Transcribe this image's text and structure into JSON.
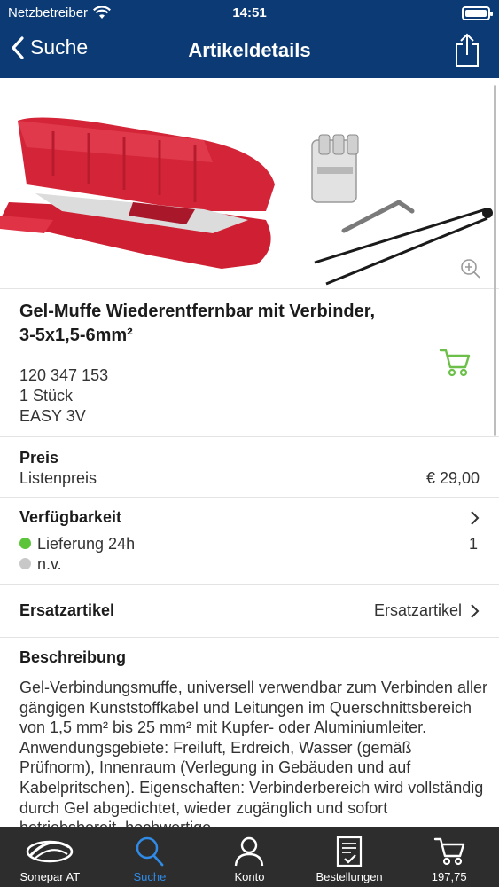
{
  "status": {
    "carrier": "Netzbetreiber",
    "time": "14:51"
  },
  "nav": {
    "back_label": "Suche",
    "title": "Artikeldetails"
  },
  "product": {
    "title": "Gel-Muffe Wiederentfernbar mit Verbinder, 3-5x1,5-6mm²",
    "article_number": "120 347 153",
    "unit": "1 Stück",
    "model": "EASY 3V"
  },
  "price": {
    "section": "Preis",
    "label": "Listenpreis",
    "value": "€ 29,00"
  },
  "availability": {
    "section": "Verfügbarkeit",
    "rows": [
      {
        "label": "Lieferung 24h",
        "value": "1",
        "color": "#5cc43a"
      },
      {
        "label": "n.v.",
        "value": "",
        "color": "#c8c8c8"
      }
    ]
  },
  "replacement": {
    "section": "Ersatzartikel",
    "value": "Ersatzartikel"
  },
  "description": {
    "section": "Beschreibung",
    "text": "Gel-Verbindungsmuffe, universell verwendbar zum Verbinden aller gängigen Kunststoffkabel und Leitungen im Querschnittsbereich von 1,5 mm² bis 25 mm² mit  Kupfer- oder Aluminiumleiter. Anwendungsgebiete: Freiluft, Erdreich, Wasser (gemäß Prüfnorm), Innenraum (Verlegung in Gebäuden und auf Kabelpritschen). Eigenschaften: Verbinderbereich wird vollständig durch Gel abgedichtet, wieder zugänglich und sofort betriebsbereit, hochwertige"
  },
  "tabs": [
    {
      "label": "Sonepar AT",
      "icon": "sonepar-logo-icon",
      "active": false
    },
    {
      "label": "Suche",
      "icon": "search-icon",
      "active": true
    },
    {
      "label": "Konto",
      "icon": "user-icon",
      "active": false
    },
    {
      "label": "Bestellungen",
      "icon": "orders-icon",
      "active": false
    },
    {
      "label": "197,75",
      "icon": "cart-icon",
      "active": false
    }
  ],
  "colors": {
    "nav": "#0b3a75",
    "accent": "#2f8be6",
    "cart_green": "#6cc04a",
    "tabbar": "#2d2d2d"
  }
}
